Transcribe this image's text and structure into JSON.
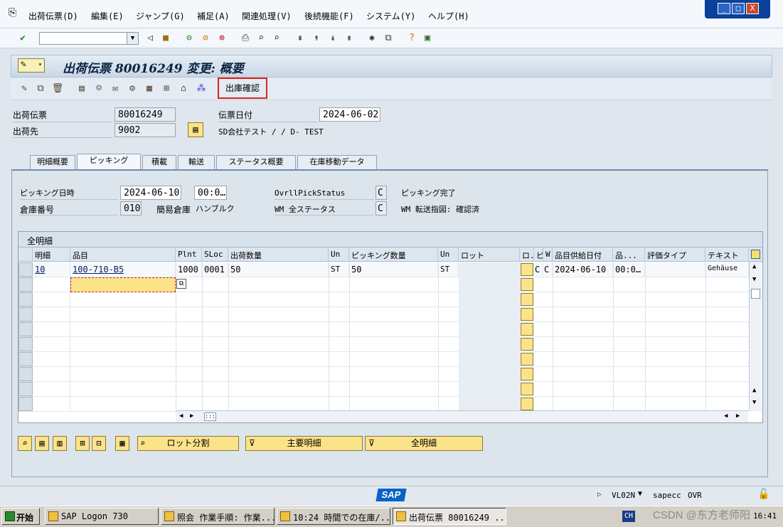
{
  "menubar": {
    "items": [
      "出荷伝票(D)",
      "編集(E)",
      "ジャンプ(G)",
      "補足(A)",
      "関連処理(V)",
      "後続機能(F)",
      "システム(Y)",
      "ヘルプ(H)"
    ]
  },
  "window_controls": {
    "minimize": "_",
    "restore": "□",
    "close": "X"
  },
  "toolbar": {
    "command_value": ""
  },
  "title": "出荷伝票 80016249 変更: 概要",
  "app_toolbar": {
    "shukko_button": "出庫確認"
  },
  "header": {
    "delivery_label": "出荷伝票",
    "delivery_value": "80016249",
    "shipto_label": "出荷先",
    "shipto_value": "9002",
    "shipto_desc": "SD会社テスト / / D- TEST",
    "docdate_label": "伝票日付",
    "docdate_value": "2024-06-02"
  },
  "tabs": [
    "明細概要",
    "ピッキング",
    "積載",
    "輸送",
    "ステータス概要",
    "在庫移動データ"
  ],
  "picking": {
    "datetime_label": "ピッキング日時",
    "date_value": "2024-06-10",
    "time_value": "00:0…",
    "ovrl_label": "OvrllPickStatus",
    "ovrl_value": "C",
    "ovrl_text": "ピッキング完了",
    "whse_label": "倉庫番号",
    "whse_value": "010",
    "whse_type_label": "簡易倉庫",
    "whse_type_text": "ハンブルク",
    "wm_label": "WM 全ステータス",
    "wm_value": "C",
    "wm_text": "WM 転送指図: 確認済"
  },
  "table": {
    "caption": "全明細",
    "headers": [
      "明細",
      "品目",
      "Plnt",
      "SLoc",
      "出荷数量",
      "Un",
      "ピッキング数量",
      "Un",
      "ロット",
      "ロ.",
      "ピ",
      "W.",
      "品目供給日付",
      "品...",
      "評価タイプ",
      "テキスト"
    ],
    "rows": [
      {
        "item": "10",
        "material": "100-710-B5",
        "plnt": "1000",
        "sloc": "0001",
        "qty": "50",
        "un": "ST",
        "pickqty": "50",
        "un2": "ST",
        "lot": "",
        "p": "C",
        "w": "C",
        "date": "2024-06-10",
        "time": "00:0…",
        "valtype": "",
        "text": "Gehäuse"
      }
    ]
  },
  "bottom_buttons": {
    "lot_split": "ロット分割",
    "main_items": "主要明細",
    "all_items": "全明細"
  },
  "status": {
    "tcode": "VL02N",
    "server": "sapecc",
    "mode": "OVR"
  },
  "taskbar": {
    "start": "开始",
    "tasks": [
      "SAP Logon 730",
      "照会 作業手順: 作業...",
      "10:24 時間での在庫/...",
      "出荷伝票 80016249 ..."
    ],
    "lang": "CH",
    "watermark": "CSDN @东方老师阳",
    "clock": "16:41"
  },
  "colors": {
    "accent": "#0a62c8",
    "highlight": "#e02020",
    "input_yellow": "#fbe38a"
  }
}
